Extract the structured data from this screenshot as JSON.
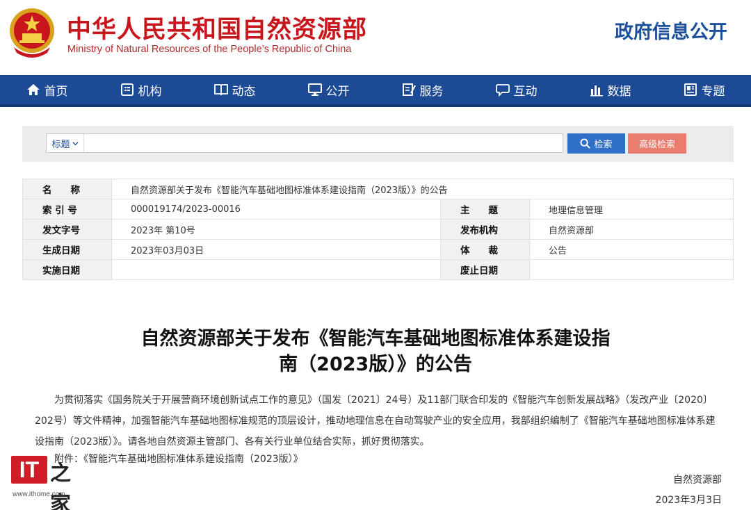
{
  "header": {
    "title": "中华人民共和国自然资源部",
    "subtitle": "Ministry of Natural Resources of the People’s Republic of China",
    "right_title": "政府信息公开",
    "brand_red": "#c8161d",
    "brand_blue": "#1b4f9c"
  },
  "nav": {
    "items": [
      {
        "label": "首页",
        "icon": "home-icon"
      },
      {
        "label": "机构",
        "icon": "org-icon"
      },
      {
        "label": "动态",
        "icon": "book-icon"
      },
      {
        "label": "公开",
        "icon": "monitor-icon"
      },
      {
        "label": "服务",
        "icon": "edit-doc-icon"
      },
      {
        "label": "互动",
        "icon": "chat-icon"
      },
      {
        "label": "数据",
        "icon": "bar-chart-icon"
      },
      {
        "label": "专题",
        "icon": "topic-icon"
      }
    ]
  },
  "search": {
    "type_label": "标题",
    "value": "",
    "placeholder": "",
    "search_label": "检索",
    "advanced_label": "高级检索"
  },
  "info": {
    "name_label": "名　　称",
    "name_value": "自然资源部关于发布《智能汽车基础地图标准体系建设指南（2023版）》的公告",
    "index_label": "索 引 号",
    "index_value": "000019174/2023-00016",
    "topic_label": "主　　题",
    "topic_value": "地理信息管理",
    "docno_label": "发文字号",
    "docno_value": "2023年 第10号",
    "publisher_label": "发布机构",
    "publisher_value": "自然资源部",
    "created_label": "生成日期",
    "created_value": "2023年03月03日",
    "genre_label": "体　　裁",
    "genre_value": "公告",
    "effective_label": "实施日期",
    "effective_value": "",
    "expire_label": "废止日期",
    "expire_value": ""
  },
  "article": {
    "title_line1": "自然资源部关于发布《智能汽车基础地图标准体系建设指",
    "title_line2": "南（2023版）》的公告",
    "paragraph": "为贯彻落实《国务院关于开展营商环境创新试点工作的意见》（国发〔2021〕24号）及11部门联合印发的《智能汽车创新发展战略》（发改产业〔2020〕202号）等文件精神，加强智能汽车基础地图标准规范的顶层设计，推动地理信息在自动驾驶产业的安全应用，我部组织编制了《智能汽车基础地图标准体系建设指南（2023版）》。请各地自然资源主管部门、各有关行业单位结合实际，抓好贯彻落实。",
    "attachment": "附件：《智能汽车基础地图标准体系建设指南（2023版）》",
    "sign_org": "自然资源部",
    "sign_date": "2023年3月3日"
  },
  "watermark": {
    "logo": "IT",
    "logo_zh": "之家",
    "url": "www.ithome.com"
  }
}
